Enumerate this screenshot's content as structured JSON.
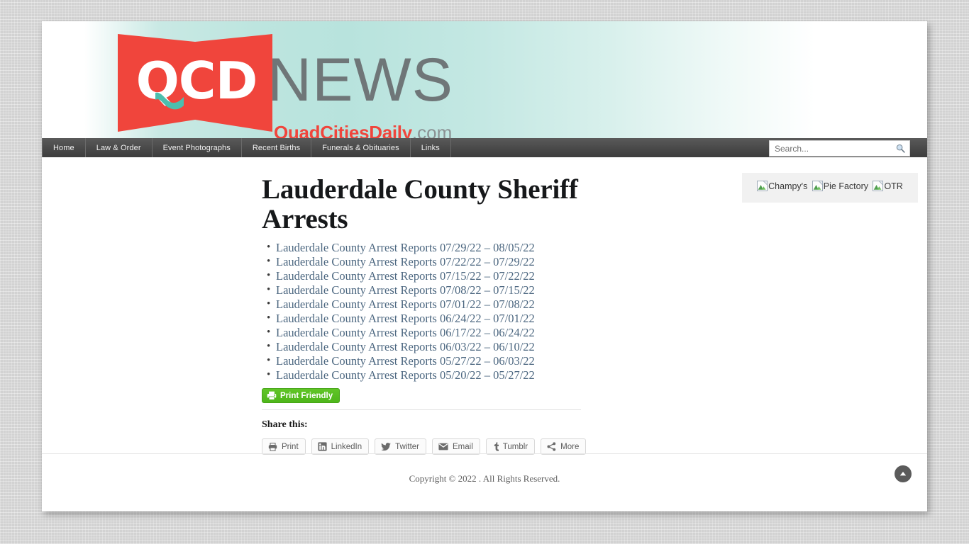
{
  "site": {
    "logo_text": "QCD",
    "logo_word": "NEWS",
    "domain_primary": "QuadCitiesDaily",
    "domain_suffix": ".com",
    "brand_red": "#f0453c",
    "brand_teal": "#4bbfae",
    "header_gradient_teal": "#b8e3dd"
  },
  "nav": {
    "items": [
      {
        "label": "Home"
      },
      {
        "label": "Law & Order"
      },
      {
        "label": "Event Photographs"
      },
      {
        "label": "Recent Births"
      },
      {
        "label": "Funerals & Obituaries"
      },
      {
        "label": "Links"
      }
    ]
  },
  "search": {
    "placeholder": "Search...",
    "value": "",
    "icon": "magnifier-icon"
  },
  "article": {
    "title": "Lauderdale County Sheriff Arrests",
    "links": [
      {
        "label": "Lauderdale County Arrest Reports 07/29/22 – 08/05/22"
      },
      {
        "label": "Lauderdale County Arrest Reports 07/22/22 – 07/29/22"
      },
      {
        "label": "Lauderdale County Arrest Reports 07/15/22 – 07/22/22"
      },
      {
        "label": "Lauderdale County Arrest Reports 07/08/22 – 07/15/22"
      },
      {
        "label": "Lauderdale County Arrest Reports 07/01/22 – 07/08/22"
      },
      {
        "label": "Lauderdale County Arrest Reports 06/24/22 – 07/01/22"
      },
      {
        "label": "Lauderdale County Arrest Reports 06/17/22 – 06/24/22"
      },
      {
        "label": "Lauderdale County Arrest Reports 06/03/22 – 06/10/22"
      },
      {
        "label": "Lauderdale County Arrest Reports 05/27/22 – 06/03/22"
      },
      {
        "label": "Lauderdale County Arrest Reports 05/20/22 – 05/27/22"
      }
    ],
    "print_friendly": {
      "label": "Print Friendly",
      "icon": "printer-icon",
      "color": "#55bd1e"
    },
    "share": {
      "heading": "Share this:",
      "buttons": [
        {
          "label": "Print",
          "icon": "printer-icon"
        },
        {
          "label": "LinkedIn",
          "icon": "linkedin-icon"
        },
        {
          "label": "Twitter",
          "icon": "twitter-bird-icon"
        },
        {
          "label": "Email",
          "icon": "envelope-icon"
        },
        {
          "label": "Tumblr",
          "icon": "tumblr-icon"
        },
        {
          "label": "More",
          "icon": "share-nodes-icon"
        }
      ]
    }
  },
  "sidebar": {
    "ads": [
      {
        "alt": "Champy's",
        "icon": "broken-image-icon"
      },
      {
        "alt": "Pie Factory",
        "icon": "broken-image-icon"
      },
      {
        "alt": "OTR",
        "icon": "broken-image-icon"
      }
    ]
  },
  "footer": {
    "copyright": "Copyright © 2022 . All Rights Reserved.",
    "scroll_top_icon": "chevron-up-circle-icon"
  }
}
